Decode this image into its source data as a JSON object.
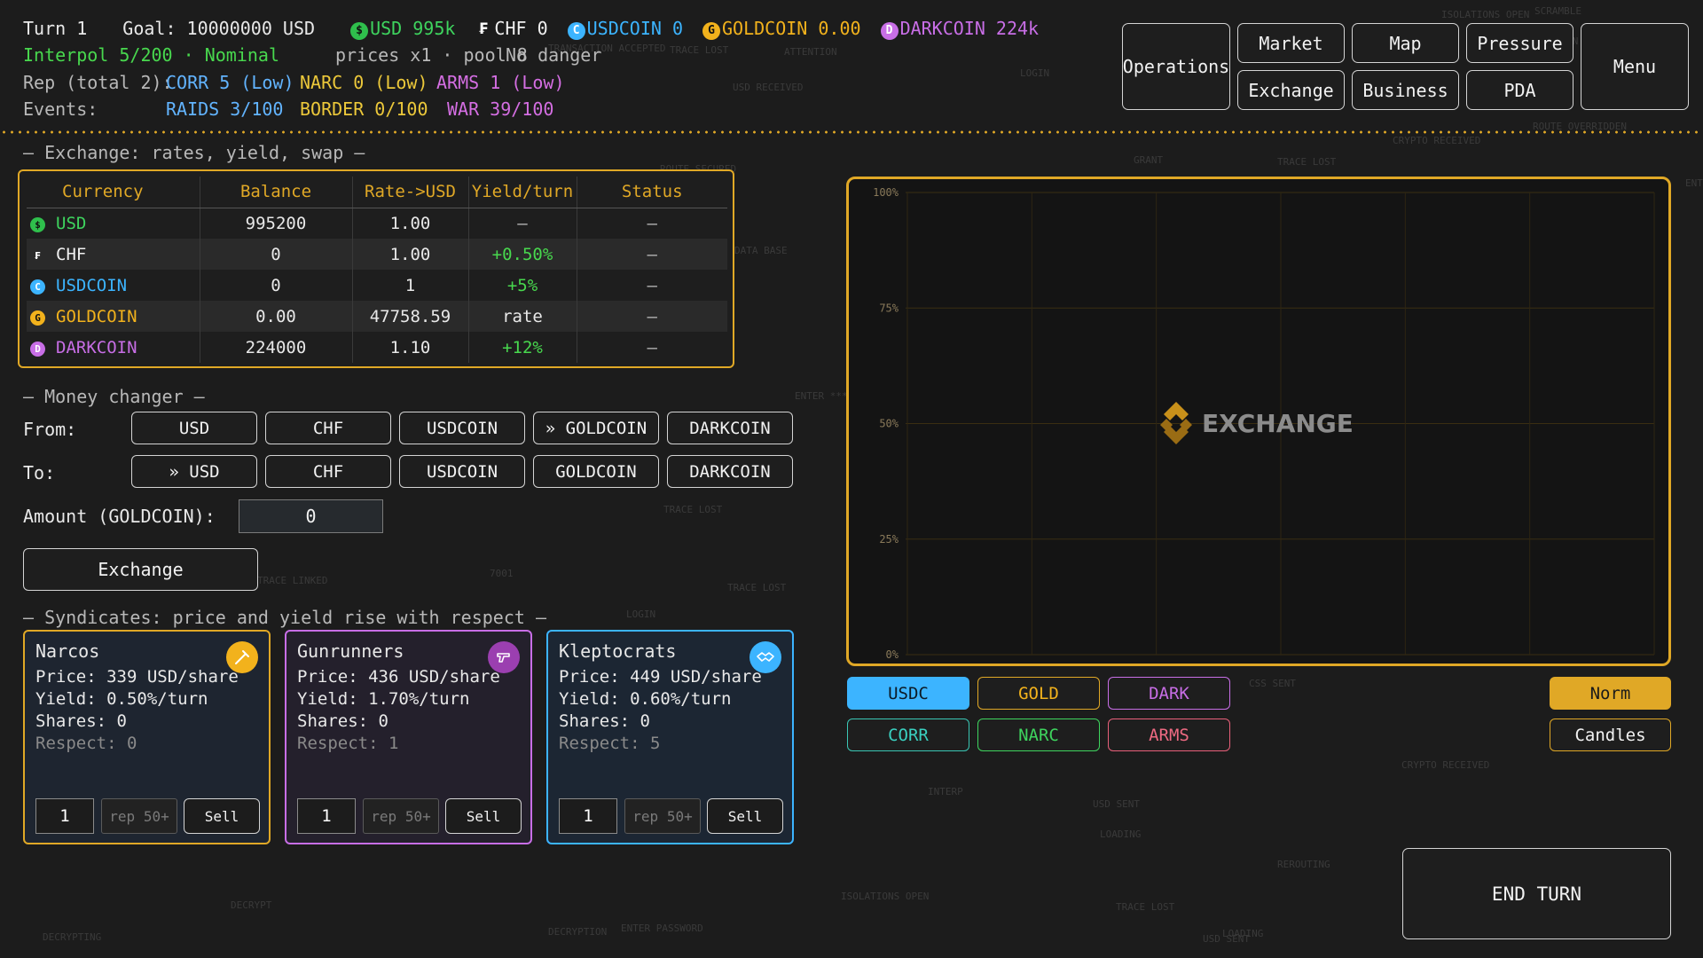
{
  "header": {
    "turn": "Turn 1",
    "goal": "Goal: 10000000 USD",
    "balances": [
      {
        "symbol": "$",
        "label": "USD 995k",
        "class": "usd"
      },
      {
        "symbol": "₣",
        "label": "CHF 0",
        "class": "chf"
      },
      {
        "symbol": "C",
        "label": "USDCOIN 0",
        "class": "usdc"
      },
      {
        "symbol": "G",
        "label": "GOLDCOIN 0.00",
        "class": "gold"
      },
      {
        "symbol": "D",
        "label": "DARKCOIN 224k",
        "class": "dark"
      }
    ],
    "interpol": "Interpol 5/200 · Nominal",
    "prices": "prices x1 · pool 8",
    "danger": "No danger",
    "rep_label": "Rep (total 2):",
    "rep_corr": "CORR 5 (Low)",
    "rep_narc": "NARC 0 (Low)",
    "rep_arms": "ARMS 1 (Low)",
    "events_label": "Events:",
    "events_raids": "RAIDS 3/100",
    "events_border": "BORDER 0/100",
    "events_war": "WAR 39/100"
  },
  "nav": {
    "operations": "Operations",
    "market": "Market",
    "map": "Map",
    "pressure": "Pressure",
    "exchange": "Exchange",
    "business": "Business",
    "pda": "PDA",
    "menu": "Menu"
  },
  "exchange_table": {
    "section_title": "— Exchange: rates, yield, swap —",
    "headers": [
      "Currency",
      "Balance",
      "Rate->USD",
      "Yield/turn",
      "Status"
    ],
    "rows": [
      {
        "icon": "$",
        "currency": "USD",
        "balance": "995200",
        "rate": "1.00",
        "yield": "—",
        "status": "—"
      },
      {
        "icon": "₣",
        "currency": "CHF",
        "balance": "0",
        "rate": "1.00",
        "yield": "+0.50%",
        "status": "—"
      },
      {
        "icon": "C",
        "currency": "USDCOIN",
        "balance": "0",
        "rate": "1",
        "yield": "+5%",
        "status": "—"
      },
      {
        "icon": "G",
        "currency": "GOLDCOIN",
        "balance": "0.00",
        "rate": "47758.59",
        "yield": "rate",
        "status": "—"
      },
      {
        "icon": "D",
        "currency": "DARKCOIN",
        "balance": "224000",
        "rate": "1.10",
        "yield": "+12%",
        "status": "—"
      }
    ]
  },
  "money_changer": {
    "section_title": "— Money changer —",
    "from_label": "From:",
    "to_label": "To:",
    "from_options": [
      "USD",
      "CHF",
      "USDCOIN",
      "» GOLDCOIN",
      "DARKCOIN"
    ],
    "to_options": [
      "» USD",
      "CHF",
      "USDCOIN",
      "GOLDCOIN",
      "DARKCOIN"
    ],
    "amount_label": "Amount (GOLDCOIN):",
    "amount_value": "0",
    "exchange_button": "Exchange"
  },
  "syndicates": {
    "section_title": "— Syndicates: price and yield rise with respect —",
    "cards": [
      {
        "name": "Narcos",
        "price": "Price: 339 USD/share",
        "yield": "Yield: 0.50%/turn",
        "shares": "Shares: 0",
        "respect": "Respect: 0",
        "qty": "1",
        "rep": "rep 50+",
        "sell": "Sell"
      },
      {
        "name": "Gunrunners",
        "price": "Price: 436 USD/share",
        "yield": "Yield: 1.70%/turn",
        "shares": "Shares: 0",
        "respect": "Respect: 1",
        "qty": "1",
        "rep": "rep 50+",
        "sell": "Sell"
      },
      {
        "name": "Kleptocrats",
        "price": "Price: 449 USD/share",
        "yield": "Yield: 0.60%/turn",
        "shares": "Shares: 0",
        "respect": "Respect: 5",
        "qty": "1",
        "rep": "rep 50+",
        "sell": "Sell"
      }
    ]
  },
  "chart": {
    "watermark": "EXCHANGE",
    "y_ticks": [
      "100%",
      "75%",
      "50%",
      "25%",
      "0%"
    ]
  },
  "chart_data": {
    "type": "line",
    "title": "",
    "xlabel": "",
    "ylabel": "",
    "y_tick_labels": [
      "0%",
      "25%",
      "50%",
      "75%",
      "100%"
    ],
    "ylim": [
      0,
      100
    ],
    "series": [],
    "grid": true,
    "watermark": "EXCHANGE"
  },
  "chart_toggles": {
    "usdc": "USDC",
    "gold": "GOLD",
    "dark": "DARK",
    "corr": "CORR",
    "narc": "NARC",
    "arms": "ARMS",
    "norm": "Norm",
    "candles": "Candles"
  },
  "end_turn": "END TURN",
  "colors": {
    "accent": "#e0a826",
    "usd": "#3ed45e",
    "usdc": "#3cb4ff",
    "gold": "#f2b21c",
    "dark": "#c86ee6"
  }
}
